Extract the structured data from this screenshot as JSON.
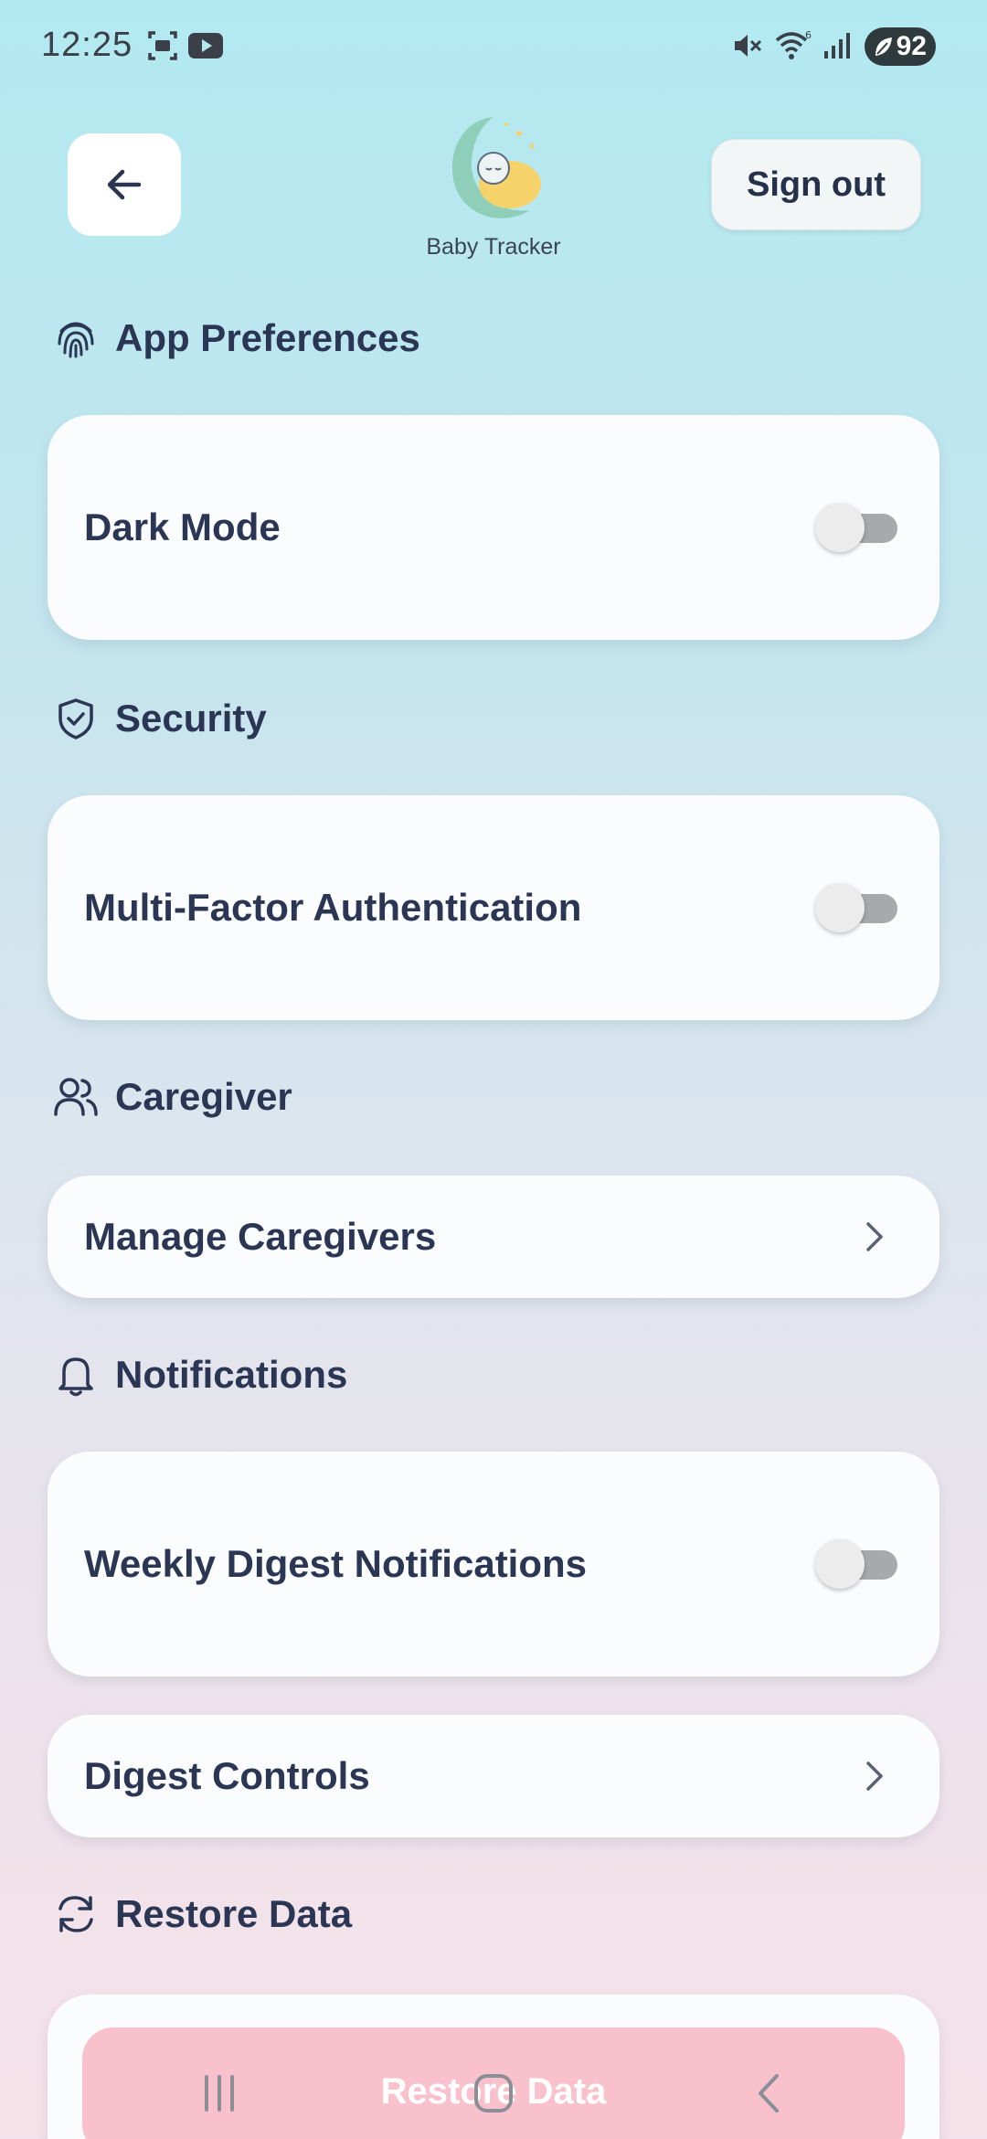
{
  "status_bar": {
    "time": "12:25",
    "battery": "92",
    "icons": [
      "screenshot-icon",
      "youtube-icon",
      "mute-icon",
      "wifi-icon",
      "signal-icon",
      "battery-icon"
    ]
  },
  "header": {
    "back_icon": "arrow-left-icon",
    "logo_text": "Baby Tracker",
    "sign_out_label": "Sign out"
  },
  "sections": {
    "app_preferences": {
      "title": "App Preferences",
      "icon": "fingerprint-icon"
    },
    "security": {
      "title": "Security",
      "icon": "shield-check-icon"
    },
    "caregiver": {
      "title": "Caregiver",
      "icon": "users-icon"
    },
    "notifications": {
      "title": "Notifications",
      "icon": "bell-icon"
    },
    "restore": {
      "title": "Restore Data",
      "icon": "refresh-icon"
    }
  },
  "settings": {
    "dark_mode": {
      "label": "Dark Mode",
      "enabled": false
    },
    "mfa": {
      "label": "Multi-Factor Authentication",
      "enabled": false
    },
    "manage_caregivers": {
      "label": "Manage Caregivers"
    },
    "weekly_digest": {
      "label": "Weekly Digest Notifications",
      "enabled": false
    },
    "digest_controls": {
      "label": "Digest Controls"
    },
    "restore_button": {
      "label": "Restore Data"
    }
  },
  "colors": {
    "text_primary": "#2b3654",
    "restore_button_bg": "#f9c1cc",
    "toggle_off_track": "#a7a9ac"
  }
}
